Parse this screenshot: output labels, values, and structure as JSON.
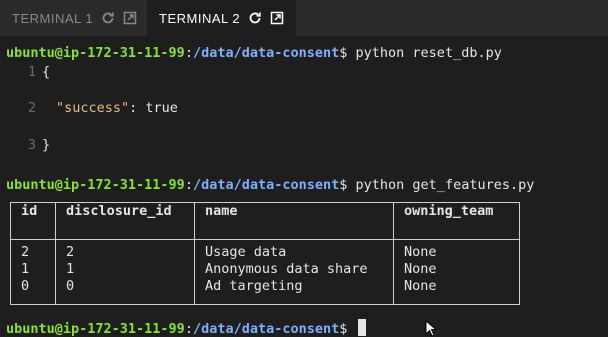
{
  "tabs": [
    {
      "label": "TERMINAL 1",
      "active": false
    },
    {
      "label": "TERMINAL 2",
      "active": true
    }
  ],
  "prompt": {
    "user": "ubuntu@ip-172-31-11-99",
    "sep": ":",
    "path": "/data/data-consent",
    "symbol": "$"
  },
  "commands": [
    {
      "text": " python reset_db.py"
    },
    {
      "text": " python get_features.py"
    },
    {
      "text": " "
    }
  ],
  "json_output": {
    "lines": [
      {
        "num": "1",
        "text": "{"
      },
      {
        "num": "2",
        "key": "\"success\"",
        "rest": ": true"
      },
      {
        "num": "3",
        "text": "}"
      }
    ]
  },
  "table": {
    "headers": [
      "id",
      "disclosure_id",
      "name",
      "owning_team"
    ],
    "columns": [
      "2\n1\n0",
      "2\n1\n0",
      "Usage data\nAnonymous data share\nAd targeting",
      "None\nNone\nNone"
    ]
  },
  "colors": {
    "user": "#8ae234",
    "path": "#7fb0ff",
    "string": "#e5c07b",
    "background": "#1e1e1e",
    "tabbar": "#2b2b2b"
  },
  "icons": {
    "tab_refresh": "refresh-icon",
    "tab_popout": "popout-icon",
    "cursor": "mouse-pointer-icon"
  }
}
